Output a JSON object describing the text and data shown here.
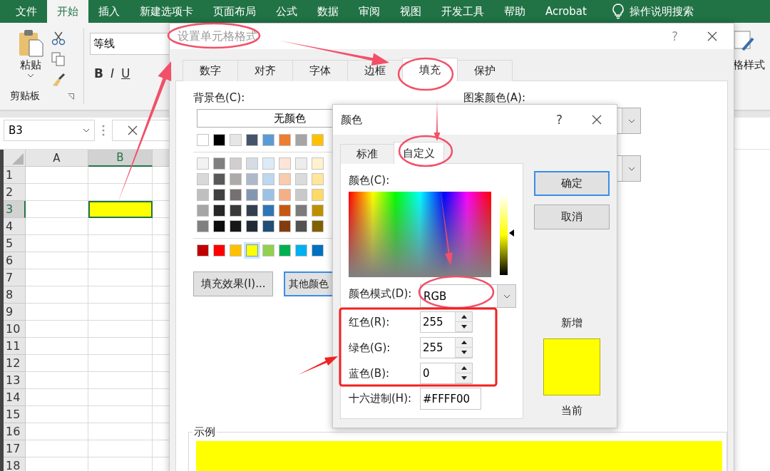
{
  "ribbon": {
    "tabs": [
      {
        "label": "文件",
        "selected": false
      },
      {
        "label": "开始",
        "selected": true
      },
      {
        "label": "插入",
        "selected": false
      },
      {
        "label": "新建选项卡",
        "selected": false
      },
      {
        "label": "页面布局",
        "selected": false
      },
      {
        "label": "公式",
        "selected": false
      },
      {
        "label": "数据",
        "selected": false
      },
      {
        "label": "审阅",
        "selected": false
      },
      {
        "label": "视图",
        "selected": false
      },
      {
        "label": "开发工具",
        "selected": false
      },
      {
        "label": "帮助",
        "selected": false
      },
      {
        "label": "Acrobat",
        "selected": false
      }
    ],
    "search": "操作说明搜索",
    "paste": "粘贴",
    "clipboard_group": "剪贴板",
    "font_name": "等线",
    "font_buttons": [
      "B",
      "I",
      "U"
    ],
    "styles_label": "格样式"
  },
  "formula_bar": {
    "name_box": "B3"
  },
  "grid": {
    "columns": [
      {
        "label": "A",
        "selected": false
      },
      {
        "label": "B",
        "selected": true
      }
    ],
    "rows": [
      {
        "label": "1",
        "selected": false
      },
      {
        "label": "2",
        "selected": false
      },
      {
        "label": "3",
        "selected": true
      },
      {
        "label": "4",
        "selected": false
      },
      {
        "label": "5",
        "selected": false
      },
      {
        "label": "6",
        "selected": false
      },
      {
        "label": "7",
        "selected": false
      },
      {
        "label": "8",
        "selected": false
      },
      {
        "label": "9",
        "selected": false
      },
      {
        "label": "10",
        "selected": false
      },
      {
        "label": "11",
        "selected": false
      },
      {
        "label": "12",
        "selected": false
      },
      {
        "label": "13",
        "selected": false
      },
      {
        "label": "14",
        "selected": false
      },
      {
        "label": "15",
        "selected": false
      },
      {
        "label": "16",
        "selected": false
      },
      {
        "label": "17",
        "selected": false
      },
      {
        "label": "18",
        "selected": false
      }
    ]
  },
  "format_dialog": {
    "title": "设置单元格格式",
    "help": "?",
    "tabs": [
      {
        "label": "数字",
        "selected": false
      },
      {
        "label": "对齐",
        "selected": false
      },
      {
        "label": "字体",
        "selected": false
      },
      {
        "label": "边框",
        "selected": false
      },
      {
        "label": "填充",
        "selected": true
      },
      {
        "label": "保护",
        "selected": false
      }
    ],
    "background_label": "背景色(C):",
    "no_color": "无颜色",
    "palette": {
      "theme": [
        {
          "color": "#ffffff",
          "selected": false
        },
        {
          "color": "#000000",
          "selected": false
        },
        {
          "color": "#e7e6e6",
          "selected": false
        },
        {
          "color": "#44546a",
          "selected": false
        },
        {
          "color": "#5b9bd5",
          "selected": false
        },
        {
          "color": "#ed7d31",
          "selected": false
        },
        {
          "color": "#a5a5a5",
          "selected": false
        },
        {
          "color": "#ffc000",
          "selected": false
        }
      ],
      "shades": [
        [
          {
            "color": "#f2f2f2",
            "selected": false
          },
          {
            "color": "#7f7f7f",
            "selected": false
          },
          {
            "color": "#d0cece",
            "selected": false
          },
          {
            "color": "#d6dce4",
            "selected": false
          },
          {
            "color": "#ddebf7",
            "selected": false
          },
          {
            "color": "#fce4d6",
            "selected": false
          },
          {
            "color": "#ededed",
            "selected": false
          },
          {
            "color": "#fff2cc",
            "selected": false
          }
        ],
        [
          {
            "color": "#d9d9d9",
            "selected": false
          },
          {
            "color": "#595959",
            "selected": false
          },
          {
            "color": "#aeaaaa",
            "selected": false
          },
          {
            "color": "#adb9ca",
            "selected": false
          },
          {
            "color": "#bdd7ee",
            "selected": false
          },
          {
            "color": "#f8cbad",
            "selected": false
          },
          {
            "color": "#dbdbdb",
            "selected": false
          },
          {
            "color": "#ffe699",
            "selected": false
          }
        ],
        [
          {
            "color": "#bfbfbf",
            "selected": false
          },
          {
            "color": "#404040",
            "selected": false
          },
          {
            "color": "#757171",
            "selected": false
          },
          {
            "color": "#8497b0",
            "selected": false
          },
          {
            "color": "#9bc2e6",
            "selected": false
          },
          {
            "color": "#f4b084",
            "selected": false
          },
          {
            "color": "#c9c9c9",
            "selected": false
          },
          {
            "color": "#ffd966",
            "selected": false
          }
        ],
        [
          {
            "color": "#a6a6a6",
            "selected": false
          },
          {
            "color": "#262626",
            "selected": false
          },
          {
            "color": "#3a3838",
            "selected": false
          },
          {
            "color": "#333f4f",
            "selected": false
          },
          {
            "color": "#2f75b5",
            "selected": false
          },
          {
            "color": "#c65911",
            "selected": false
          },
          {
            "color": "#7b7b7b",
            "selected": false
          },
          {
            "color": "#bf8f00",
            "selected": false
          }
        ],
        [
          {
            "color": "#808080",
            "selected": false
          },
          {
            "color": "#0d0d0d",
            "selected": false
          },
          {
            "color": "#171616",
            "selected": false
          },
          {
            "color": "#222b35",
            "selected": false
          },
          {
            "color": "#1f4e78",
            "selected": false
          },
          {
            "color": "#833c0c",
            "selected": false
          },
          {
            "color": "#525252",
            "selected": false
          },
          {
            "color": "#806000",
            "selected": false
          }
        ]
      ],
      "standard": [
        {
          "color": "#c00000",
          "selected": false
        },
        {
          "color": "#ff0000",
          "selected": false
        },
        {
          "color": "#ffc000",
          "selected": false
        },
        {
          "color": "#ffff00",
          "selected": true
        },
        {
          "color": "#92d050",
          "selected": false
        },
        {
          "color": "#00b050",
          "selected": false
        },
        {
          "color": "#00b0f0",
          "selected": false
        },
        {
          "color": "#0070c0",
          "selected": false
        }
      ]
    },
    "fill_effects": "填充效果(I)...",
    "more_colors": "其他颜色",
    "pattern_color_label": "图案颜色(A):",
    "sample_label": "示例"
  },
  "color_dialog": {
    "title": "颜色",
    "help": "?",
    "tabs": [
      {
        "label": "标准",
        "selected": false
      },
      {
        "label": "自定义",
        "selected": true
      }
    ],
    "colors_label": "颜色(C):",
    "luminance": {
      "level": 0.52
    },
    "mode_label": "颜色模式(D):",
    "mode": "RGB",
    "channels": [
      {
        "label": "红色(R):",
        "value": "255"
      },
      {
        "label": "绿色(G):",
        "value": "255"
      },
      {
        "label": "蓝色(B):",
        "value": "0"
      }
    ],
    "hex_label": "十六进制(H):",
    "hex": "#FFFF00",
    "ok": "确定",
    "cancel": "取消",
    "new_label": "新增",
    "current_label": "当前"
  }
}
